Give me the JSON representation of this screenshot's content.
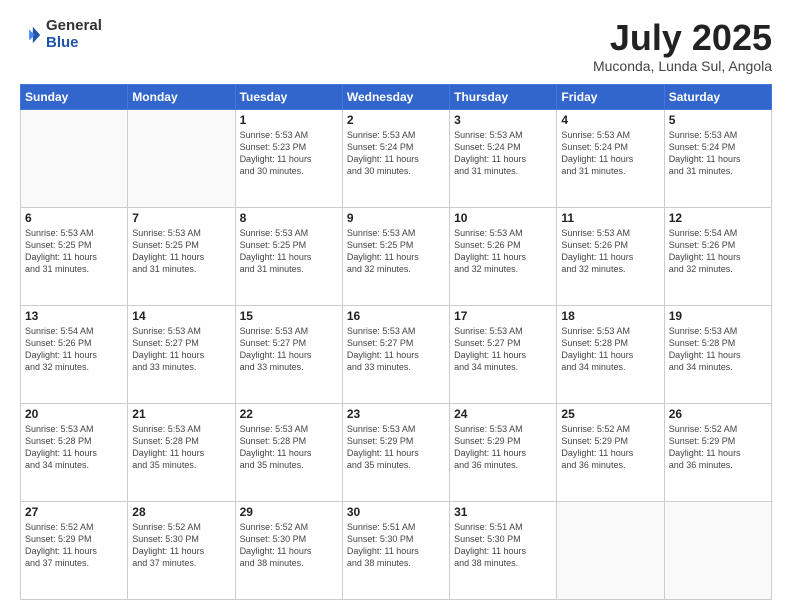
{
  "header": {
    "logo_general": "General",
    "logo_blue": "Blue",
    "month_title": "July 2025",
    "location": "Muconda, Lunda Sul, Angola"
  },
  "days_of_week": [
    "Sunday",
    "Monday",
    "Tuesday",
    "Wednesday",
    "Thursday",
    "Friday",
    "Saturday"
  ],
  "weeks": [
    [
      {
        "day": "",
        "info": ""
      },
      {
        "day": "",
        "info": ""
      },
      {
        "day": "1",
        "info": "Sunrise: 5:53 AM\nSunset: 5:23 PM\nDaylight: 11 hours\nand 30 minutes."
      },
      {
        "day": "2",
        "info": "Sunrise: 5:53 AM\nSunset: 5:24 PM\nDaylight: 11 hours\nand 30 minutes."
      },
      {
        "day": "3",
        "info": "Sunrise: 5:53 AM\nSunset: 5:24 PM\nDaylight: 11 hours\nand 31 minutes."
      },
      {
        "day": "4",
        "info": "Sunrise: 5:53 AM\nSunset: 5:24 PM\nDaylight: 11 hours\nand 31 minutes."
      },
      {
        "day": "5",
        "info": "Sunrise: 5:53 AM\nSunset: 5:24 PM\nDaylight: 11 hours\nand 31 minutes."
      }
    ],
    [
      {
        "day": "6",
        "info": "Sunrise: 5:53 AM\nSunset: 5:25 PM\nDaylight: 11 hours\nand 31 minutes."
      },
      {
        "day": "7",
        "info": "Sunrise: 5:53 AM\nSunset: 5:25 PM\nDaylight: 11 hours\nand 31 minutes."
      },
      {
        "day": "8",
        "info": "Sunrise: 5:53 AM\nSunset: 5:25 PM\nDaylight: 11 hours\nand 31 minutes."
      },
      {
        "day": "9",
        "info": "Sunrise: 5:53 AM\nSunset: 5:25 PM\nDaylight: 11 hours\nand 32 minutes."
      },
      {
        "day": "10",
        "info": "Sunrise: 5:53 AM\nSunset: 5:26 PM\nDaylight: 11 hours\nand 32 minutes."
      },
      {
        "day": "11",
        "info": "Sunrise: 5:53 AM\nSunset: 5:26 PM\nDaylight: 11 hours\nand 32 minutes."
      },
      {
        "day": "12",
        "info": "Sunrise: 5:54 AM\nSunset: 5:26 PM\nDaylight: 11 hours\nand 32 minutes."
      }
    ],
    [
      {
        "day": "13",
        "info": "Sunrise: 5:54 AM\nSunset: 5:26 PM\nDaylight: 11 hours\nand 32 minutes."
      },
      {
        "day": "14",
        "info": "Sunrise: 5:53 AM\nSunset: 5:27 PM\nDaylight: 11 hours\nand 33 minutes."
      },
      {
        "day": "15",
        "info": "Sunrise: 5:53 AM\nSunset: 5:27 PM\nDaylight: 11 hours\nand 33 minutes."
      },
      {
        "day": "16",
        "info": "Sunrise: 5:53 AM\nSunset: 5:27 PM\nDaylight: 11 hours\nand 33 minutes."
      },
      {
        "day": "17",
        "info": "Sunrise: 5:53 AM\nSunset: 5:27 PM\nDaylight: 11 hours\nand 34 minutes."
      },
      {
        "day": "18",
        "info": "Sunrise: 5:53 AM\nSunset: 5:28 PM\nDaylight: 11 hours\nand 34 minutes."
      },
      {
        "day": "19",
        "info": "Sunrise: 5:53 AM\nSunset: 5:28 PM\nDaylight: 11 hours\nand 34 minutes."
      }
    ],
    [
      {
        "day": "20",
        "info": "Sunrise: 5:53 AM\nSunset: 5:28 PM\nDaylight: 11 hours\nand 34 minutes."
      },
      {
        "day": "21",
        "info": "Sunrise: 5:53 AM\nSunset: 5:28 PM\nDaylight: 11 hours\nand 35 minutes."
      },
      {
        "day": "22",
        "info": "Sunrise: 5:53 AM\nSunset: 5:28 PM\nDaylight: 11 hours\nand 35 minutes."
      },
      {
        "day": "23",
        "info": "Sunrise: 5:53 AM\nSunset: 5:29 PM\nDaylight: 11 hours\nand 35 minutes."
      },
      {
        "day": "24",
        "info": "Sunrise: 5:53 AM\nSunset: 5:29 PM\nDaylight: 11 hours\nand 36 minutes."
      },
      {
        "day": "25",
        "info": "Sunrise: 5:52 AM\nSunset: 5:29 PM\nDaylight: 11 hours\nand 36 minutes."
      },
      {
        "day": "26",
        "info": "Sunrise: 5:52 AM\nSunset: 5:29 PM\nDaylight: 11 hours\nand 36 minutes."
      }
    ],
    [
      {
        "day": "27",
        "info": "Sunrise: 5:52 AM\nSunset: 5:29 PM\nDaylight: 11 hours\nand 37 minutes."
      },
      {
        "day": "28",
        "info": "Sunrise: 5:52 AM\nSunset: 5:30 PM\nDaylight: 11 hours\nand 37 minutes."
      },
      {
        "day": "29",
        "info": "Sunrise: 5:52 AM\nSunset: 5:30 PM\nDaylight: 11 hours\nand 38 minutes."
      },
      {
        "day": "30",
        "info": "Sunrise: 5:51 AM\nSunset: 5:30 PM\nDaylight: 11 hours\nand 38 minutes."
      },
      {
        "day": "31",
        "info": "Sunrise: 5:51 AM\nSunset: 5:30 PM\nDaylight: 11 hours\nand 38 minutes."
      },
      {
        "day": "",
        "info": ""
      },
      {
        "day": "",
        "info": ""
      }
    ]
  ]
}
